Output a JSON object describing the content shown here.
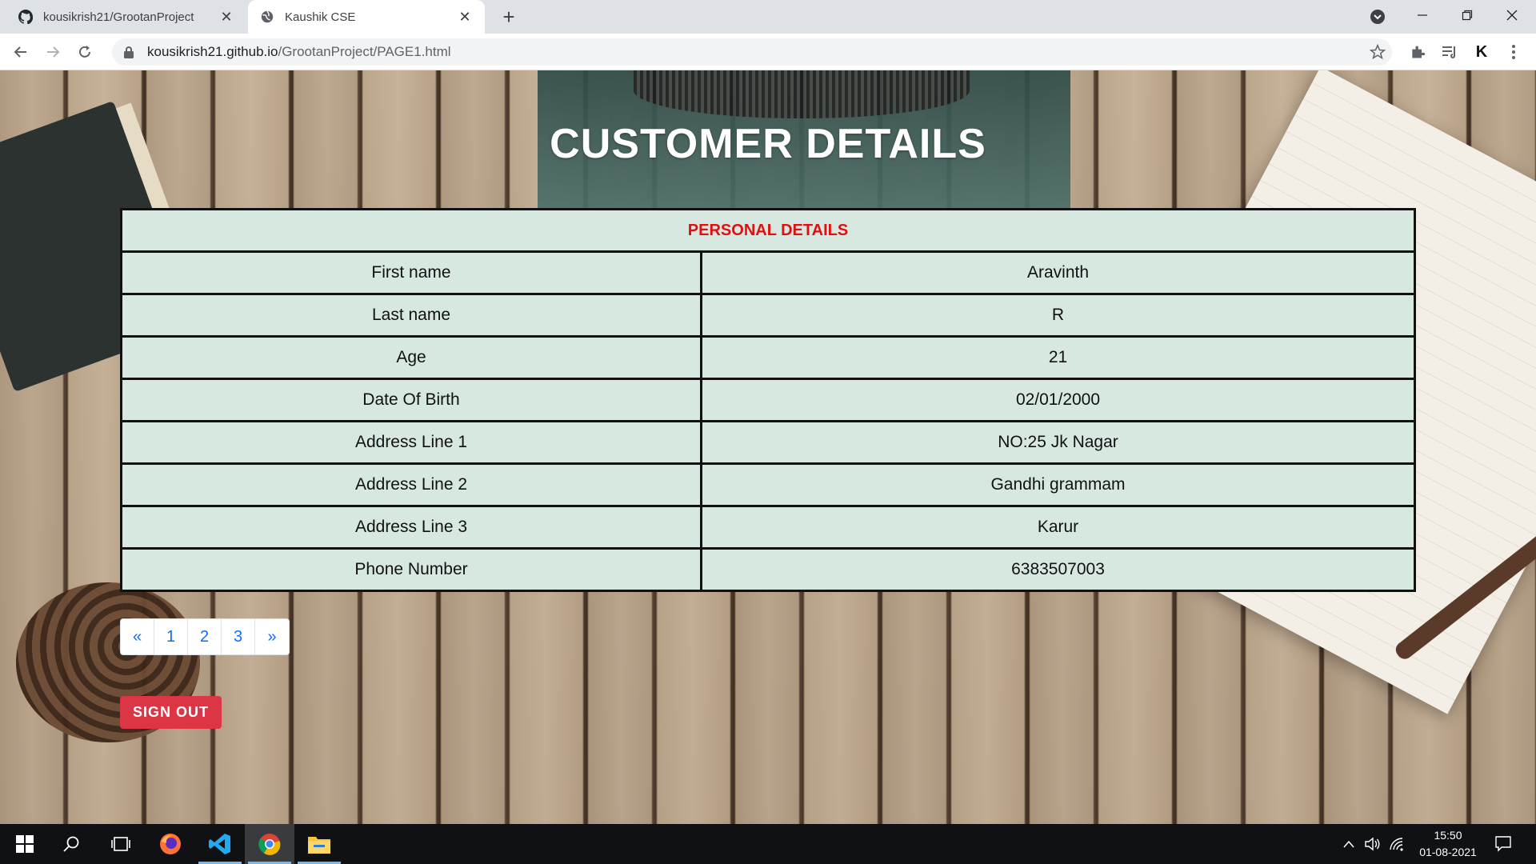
{
  "browser": {
    "tabs": [
      {
        "title": "kousikrish21/GrootanProject",
        "active": false
      },
      {
        "title": "Kaushik CSE",
        "active": true
      }
    ],
    "url_domain": "kousikrish21.github.io",
    "url_path": "/GrootanProject/PAGE1.html"
  },
  "page": {
    "title": "CUSTOMER DETAILS",
    "table_header": "PERSONAL DETAILS",
    "rows": [
      {
        "label": "First name",
        "value": "Aravinth"
      },
      {
        "label": "Last name",
        "value": "R"
      },
      {
        "label": "Age",
        "value": "21"
      },
      {
        "label": "Date Of Birth",
        "value": "02/01/2000"
      },
      {
        "label": "Address Line 1",
        "value": "NO:25 Jk Nagar"
      },
      {
        "label": "Address Line 2",
        "value": "Gandhi grammam"
      },
      {
        "label": "Address Line 3",
        "value": "Karur"
      },
      {
        "label": "Phone Number",
        "value": "6383507003"
      }
    ],
    "pagination": {
      "prev": "«",
      "pages": [
        "1",
        "2",
        "3"
      ],
      "next": "»"
    },
    "signout_label": "SIGN OUT"
  },
  "taskbar": {
    "apps": [
      "windows-start",
      "search",
      "task-view",
      "firefox",
      "vscode",
      "chrome",
      "file-explorer"
    ],
    "active_app": "chrome",
    "time": "15:50",
    "date": "01-08-2021"
  },
  "colors": {
    "header_red": "#e01010",
    "table_bg": "#d6e8e0",
    "signout_bg": "#dc3545",
    "link_blue": "#0d6efd"
  }
}
